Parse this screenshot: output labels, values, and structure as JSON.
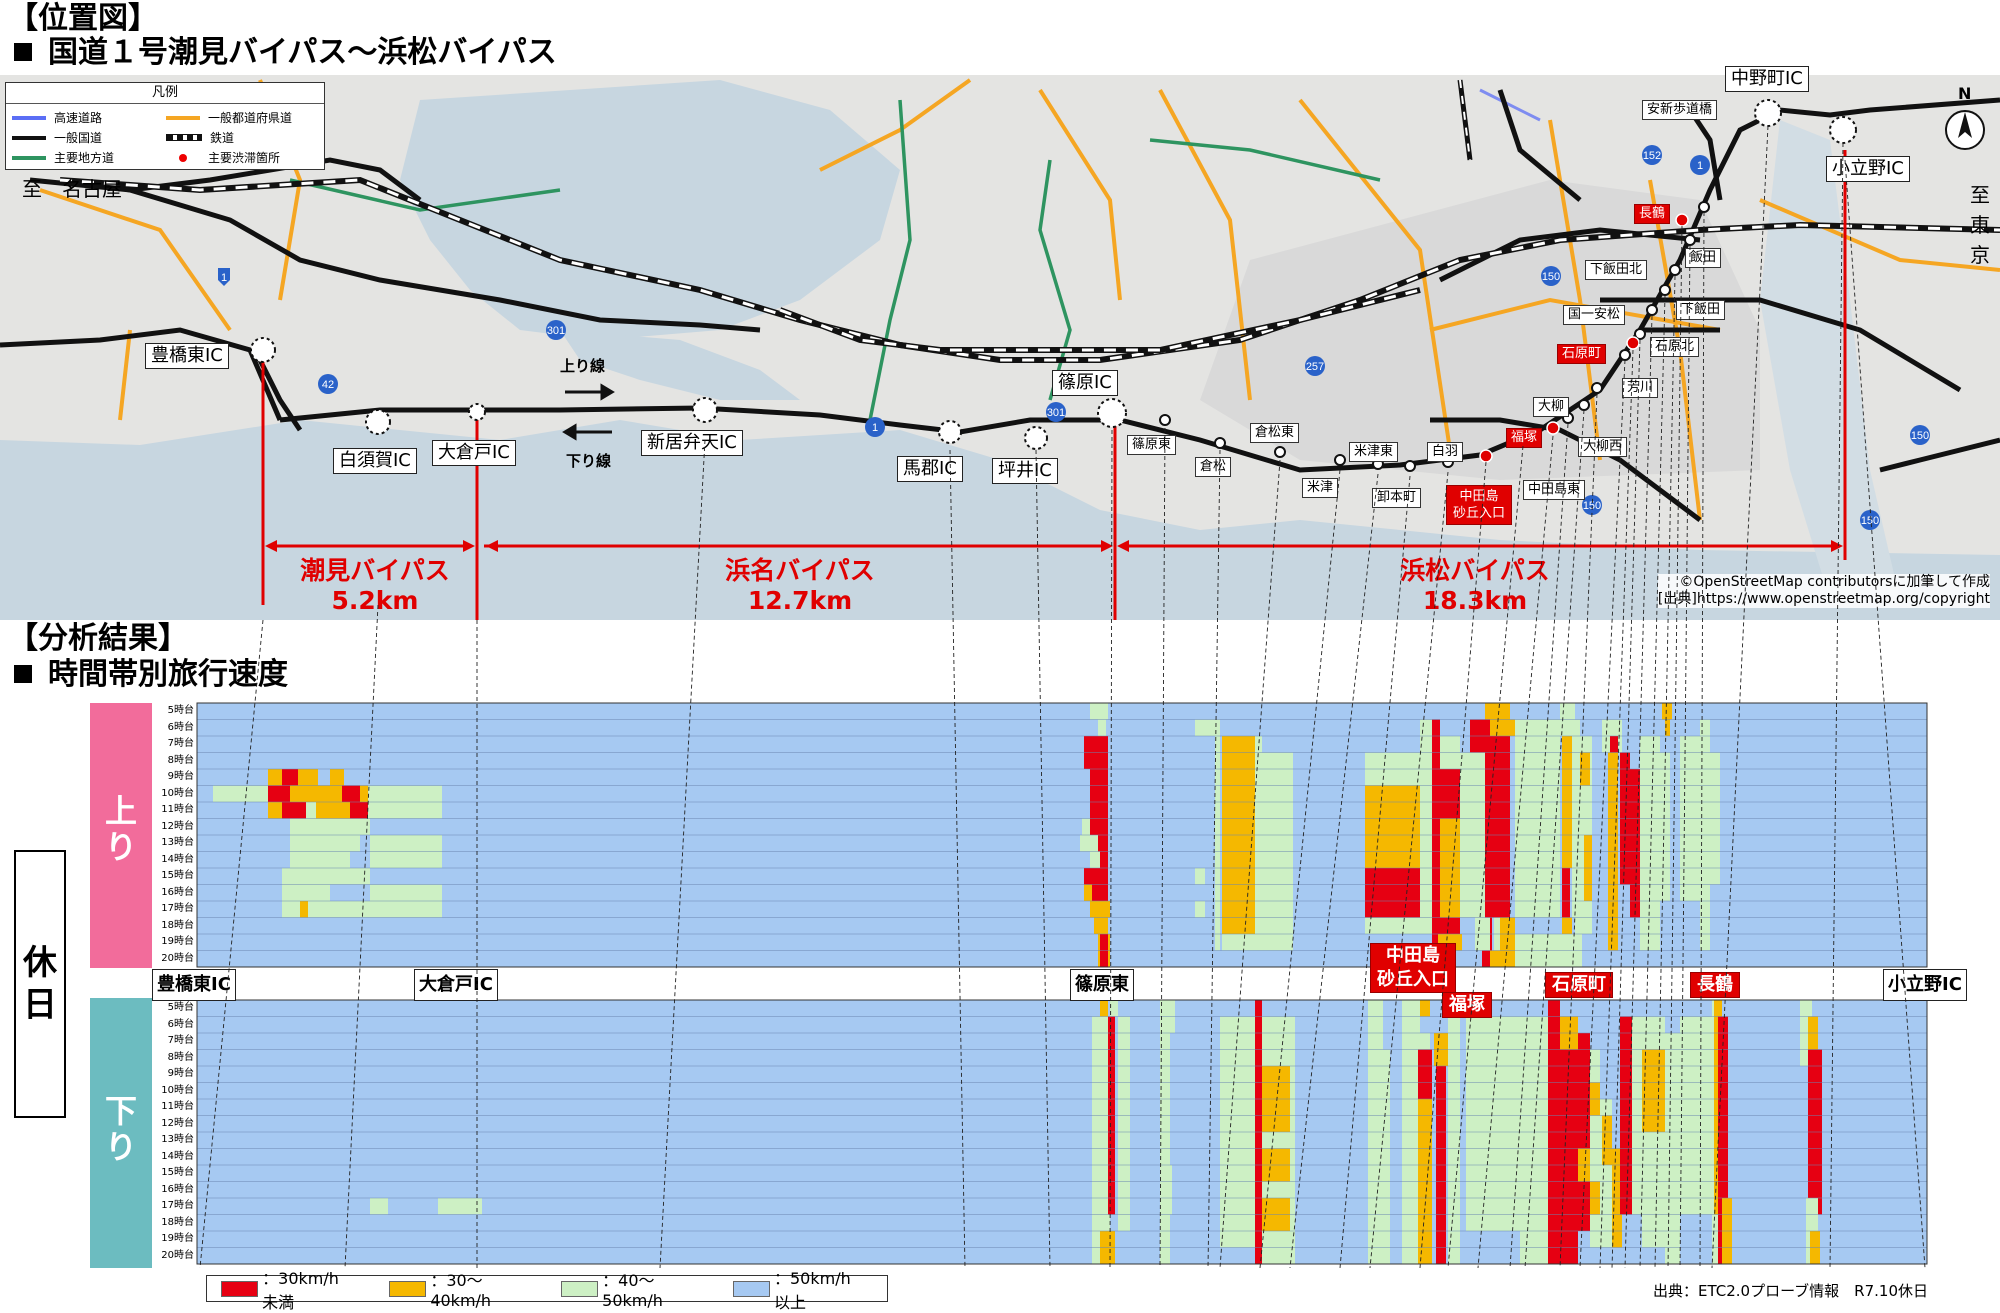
{
  "header": {
    "location_title": "【位置図】",
    "route_title": "国道１号潮見バイパス～浜松バイパス",
    "analysis_title": "【分析結果】",
    "speed_title": "時間帯別旅行速度"
  },
  "map": {
    "legend": {
      "title": "凡例",
      "items": [
        {
          "label": "高速道路",
          "color": "#5b6ef5"
        },
        {
          "label": "一般都道府県道",
          "color": "#f5a623"
        },
        {
          "label": "一般国道",
          "color": "#111111"
        },
        {
          "label": "鉄道",
          "color": "#111111"
        },
        {
          "label": "主要地方道",
          "color": "#2e9460"
        },
        {
          "label": "主要渋滞箇所",
          "color": "#e00000"
        }
      ]
    },
    "to_nagoya": "至　名古屋",
    "to_tokyo": "至\n東京",
    "north": "N",
    "arrow_up": "上り線",
    "arrow_down": "下り線",
    "ic_labels": [
      "豊橋東IC",
      "白須賀IC",
      "大倉戸IC",
      "新居弁天IC",
      "馬郡IC",
      "坪井IC",
      "篠原IC",
      "中野町IC",
      "小立野IC"
    ],
    "points": [
      "篠原東",
      "倉松",
      "倉松東",
      "米津",
      "米津東",
      "卸本町",
      "白羽",
      "中田島東",
      "大柳",
      "大柳西",
      "芳川",
      "石原北",
      "下飯田",
      "国一安松",
      "下飯田北",
      "飯田",
      "安新歩道橋"
    ],
    "congestion_points": [
      "中田島\n砂丘入口",
      "福塚",
      "石原町",
      "長鶴"
    ],
    "route_shields": [
      "1",
      "1",
      "1",
      "42",
      "301",
      "301",
      "257",
      "150",
      "150",
      "150",
      "150",
      "152"
    ],
    "sections": [
      {
        "name": "潮見バイパス",
        "length": "5.2km"
      },
      {
        "name": "浜名バイパス",
        "length": "12.7km"
      },
      {
        "name": "浜松バイパス",
        "length": "18.3km"
      }
    ],
    "credit_line1": "©OpenStreetMap contributorsに加筆して作成",
    "credit_line2": "[出典]https://www.openstreetmap.org/copyright"
  },
  "analysis": {
    "holiday_label": "休日",
    "up_label": "上り",
    "down_label": "下り",
    "hours": [
      "5時台",
      "6時台",
      "7時台",
      "8時台",
      "9時台",
      "10時台",
      "11時台",
      "12時台",
      "13時台",
      "14時台",
      "15時台",
      "16時台",
      "17時台",
      "18時台",
      "19時台",
      "20時台"
    ],
    "ic_markers": [
      "豊橋東IC",
      "大倉戸IC",
      "篠原東",
      "小立野IC"
    ],
    "congestion_markers": [
      "中田島\n砂丘入口",
      "福塚",
      "石原町",
      "長鶴"
    ],
    "speed_legend": [
      {
        "label": "：30km/h未満",
        "color": "#e60012"
      },
      {
        "label": "：30～40km/h",
        "color": "#f5b800"
      },
      {
        "label": "：40～50km/h",
        "color": "#cdf0c4"
      },
      {
        "label": "：50km/h以上",
        "color": "#a6c9f2"
      }
    ],
    "source": "出典：ETC2.0プローブ情報　R7.10休日"
  }
}
